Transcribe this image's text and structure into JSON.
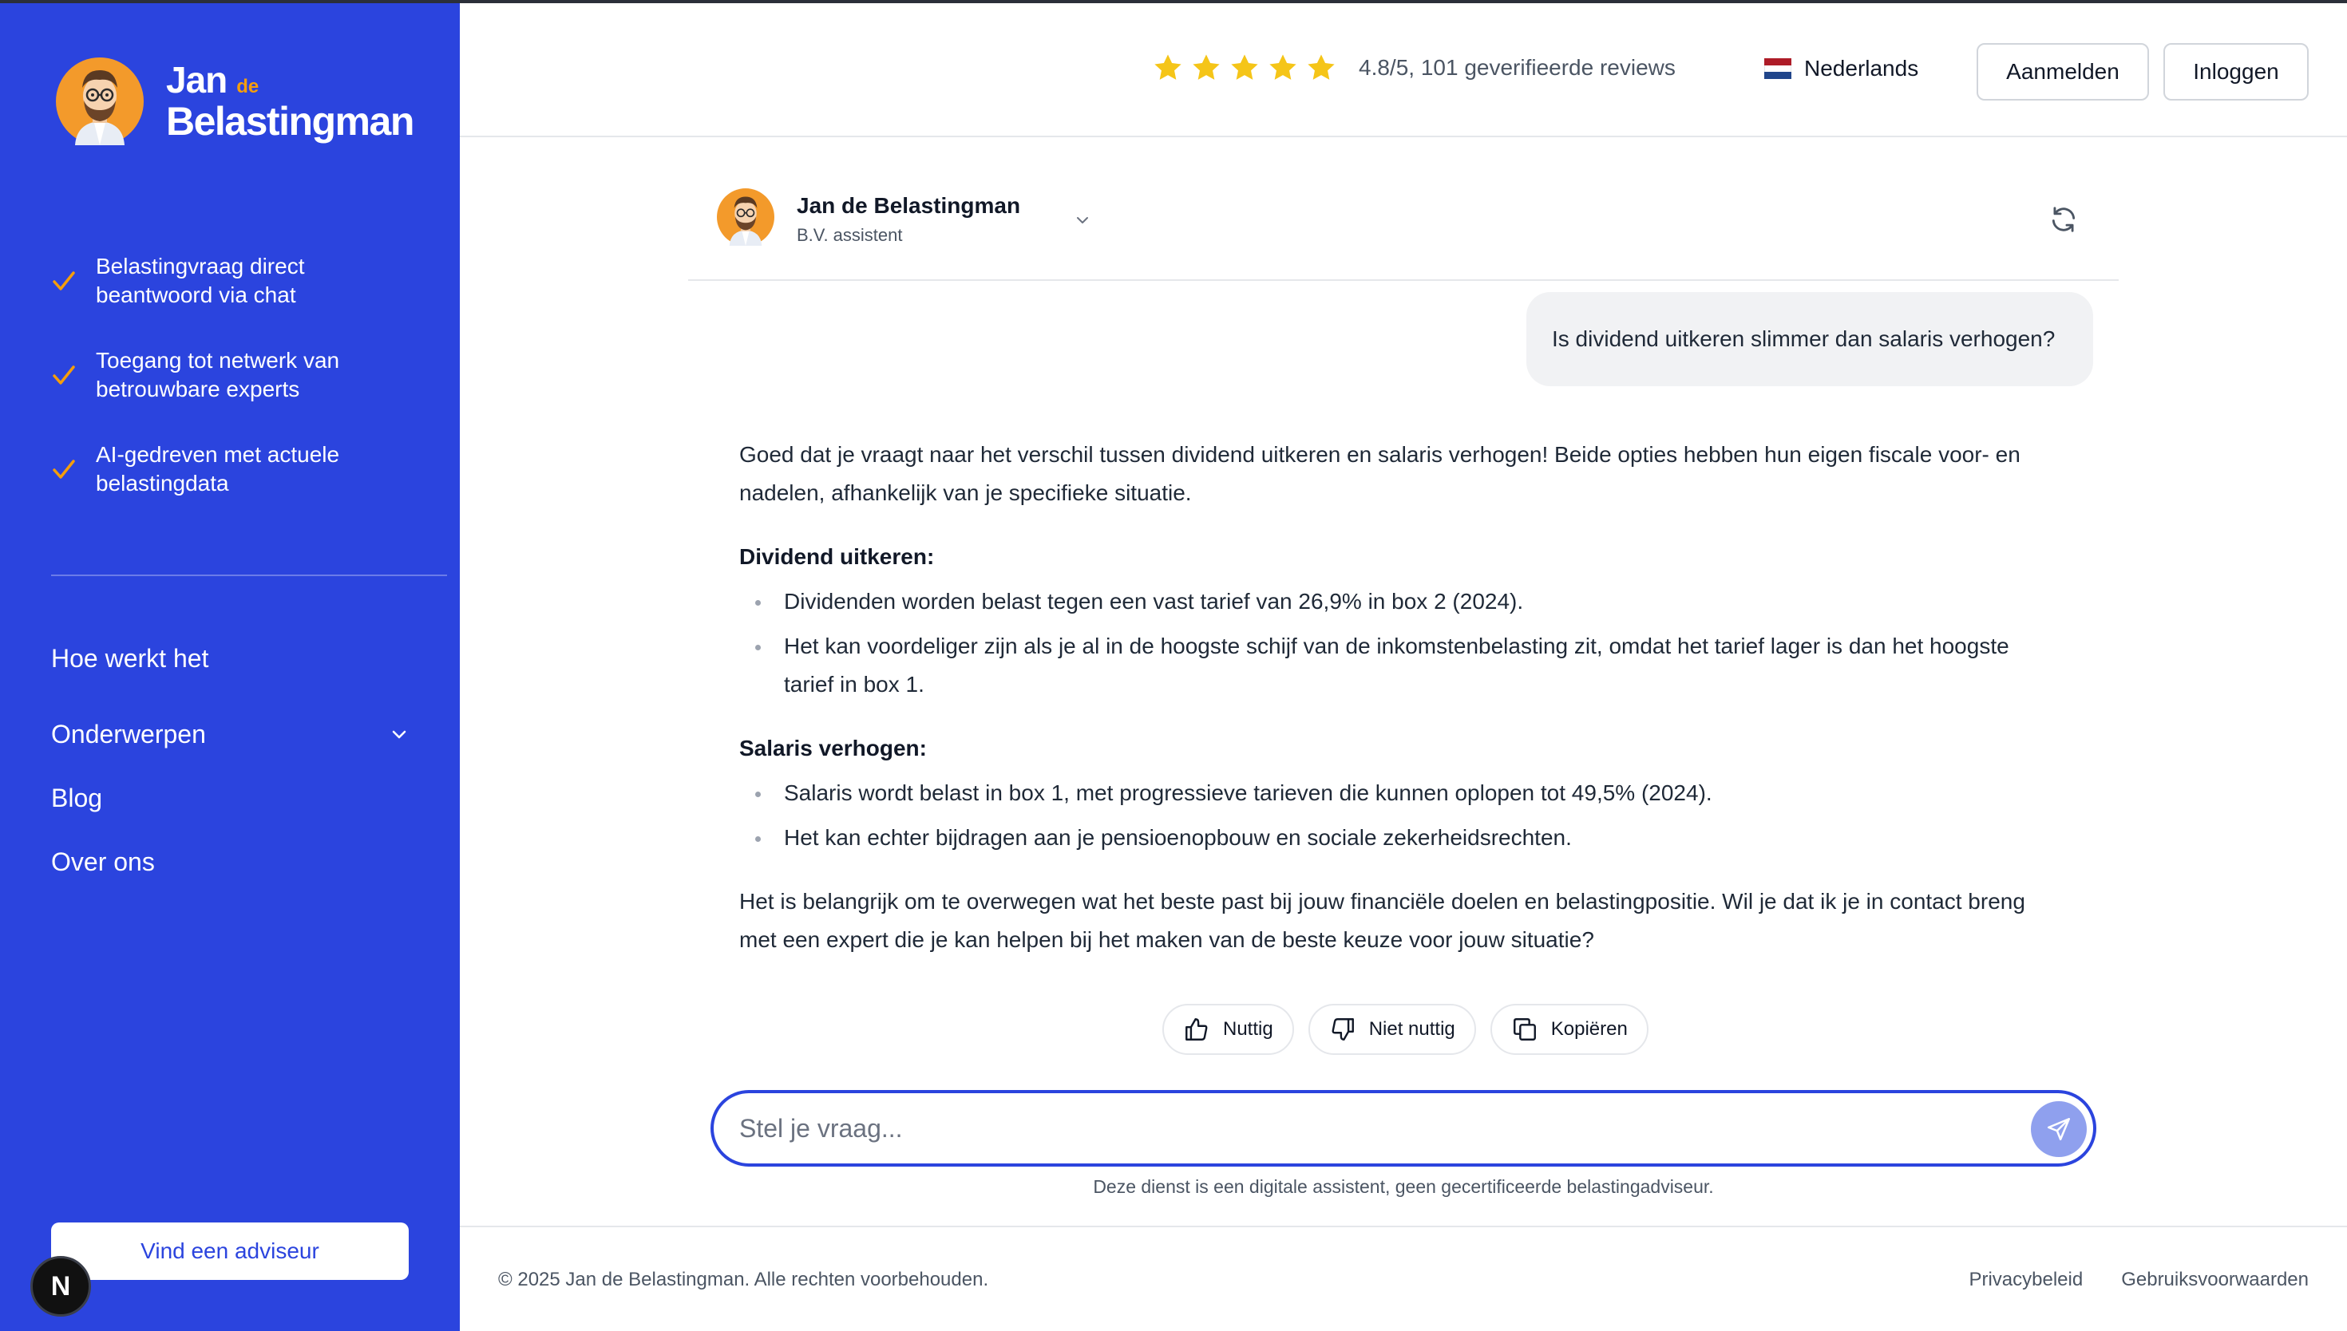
{
  "brand": {
    "name_first": "Jan",
    "name_de": "de",
    "name_last": "Belastingman"
  },
  "sidebar": {
    "features": [
      {
        "line1": "Belastingvraag direct",
        "line2": "beantwoord via chat"
      },
      {
        "line1": "Toegang tot netwerk van",
        "line2": "betrouwbare experts"
      },
      {
        "line1": "AI-gedreven met actuele",
        "line2": "belastingdata"
      }
    ],
    "nav": [
      {
        "label": "Hoe werkt het"
      },
      {
        "label": "Onderwerpen"
      },
      {
        "label": "Blog"
      },
      {
        "label": "Over ons"
      }
    ],
    "cta_label": "Vind een adviseur",
    "badge_letter": "N"
  },
  "header": {
    "rating": {
      "stars": 5,
      "text": "4.8/5, 101 geverifieerde reviews"
    },
    "language": "Nederlands",
    "signup_label": "Aanmelden",
    "login_label": "Inloggen"
  },
  "chat": {
    "bot_name": "Jan de Belastingman",
    "bot_role": "B.V. assistent",
    "user_message": "Is dividend uitkeren slimmer dan salaris verhogen?",
    "answer": {
      "intro": "Goed dat je vraagt naar het verschil tussen dividend uitkeren en salaris verhogen! Beide opties hebben hun eigen fiscale voor- en nadelen, afhankelijk van je specifieke situatie.",
      "section1_title": "Dividend uitkeren:",
      "section1_items": [
        "Dividenden worden belast tegen een vast tarief van 26,9% in box 2 (2024).",
        "Het kan voordeliger zijn als je al in de hoogste schijf van de inkomstenbelasting zit, omdat het tarief lager is dan het hoogste tarief in box 1."
      ],
      "section2_title": "Salaris verhogen:",
      "section2_items": [
        "Salaris wordt belast in box 1, met progressieve tarieven die kunnen oplopen tot 49,5% (2024).",
        "Het kan echter bijdragen aan je pensioenopbouw en sociale zekerheidsrechten."
      ],
      "closing": "Het is belangrijk om te overwegen wat het beste past bij jouw financiële doelen en belastingpositie. Wil je dat ik je in contact breng met een expert die je kan helpen bij het maken van de beste keuze voor jouw situatie?"
    },
    "feedback": {
      "useful": "Nuttig",
      "not_useful": "Niet nuttig",
      "copy": "Kopiëren"
    },
    "input_placeholder": "Stel je vraag...",
    "disclaimer": "Deze dienst is een digitale assistent, geen gecertificeerde belastingadviseur."
  },
  "footer": {
    "copyright": "© 2025 Jan de Belastingman. Alle rechten voorbehouden.",
    "privacy": "Privacybeleid",
    "terms": "Gebruiksvoorwaarden"
  },
  "colors": {
    "brand_blue": "#2b44de",
    "star": "#f5c518",
    "accent_orange": "#f59e0b",
    "send_button": "#8fa0ee"
  }
}
